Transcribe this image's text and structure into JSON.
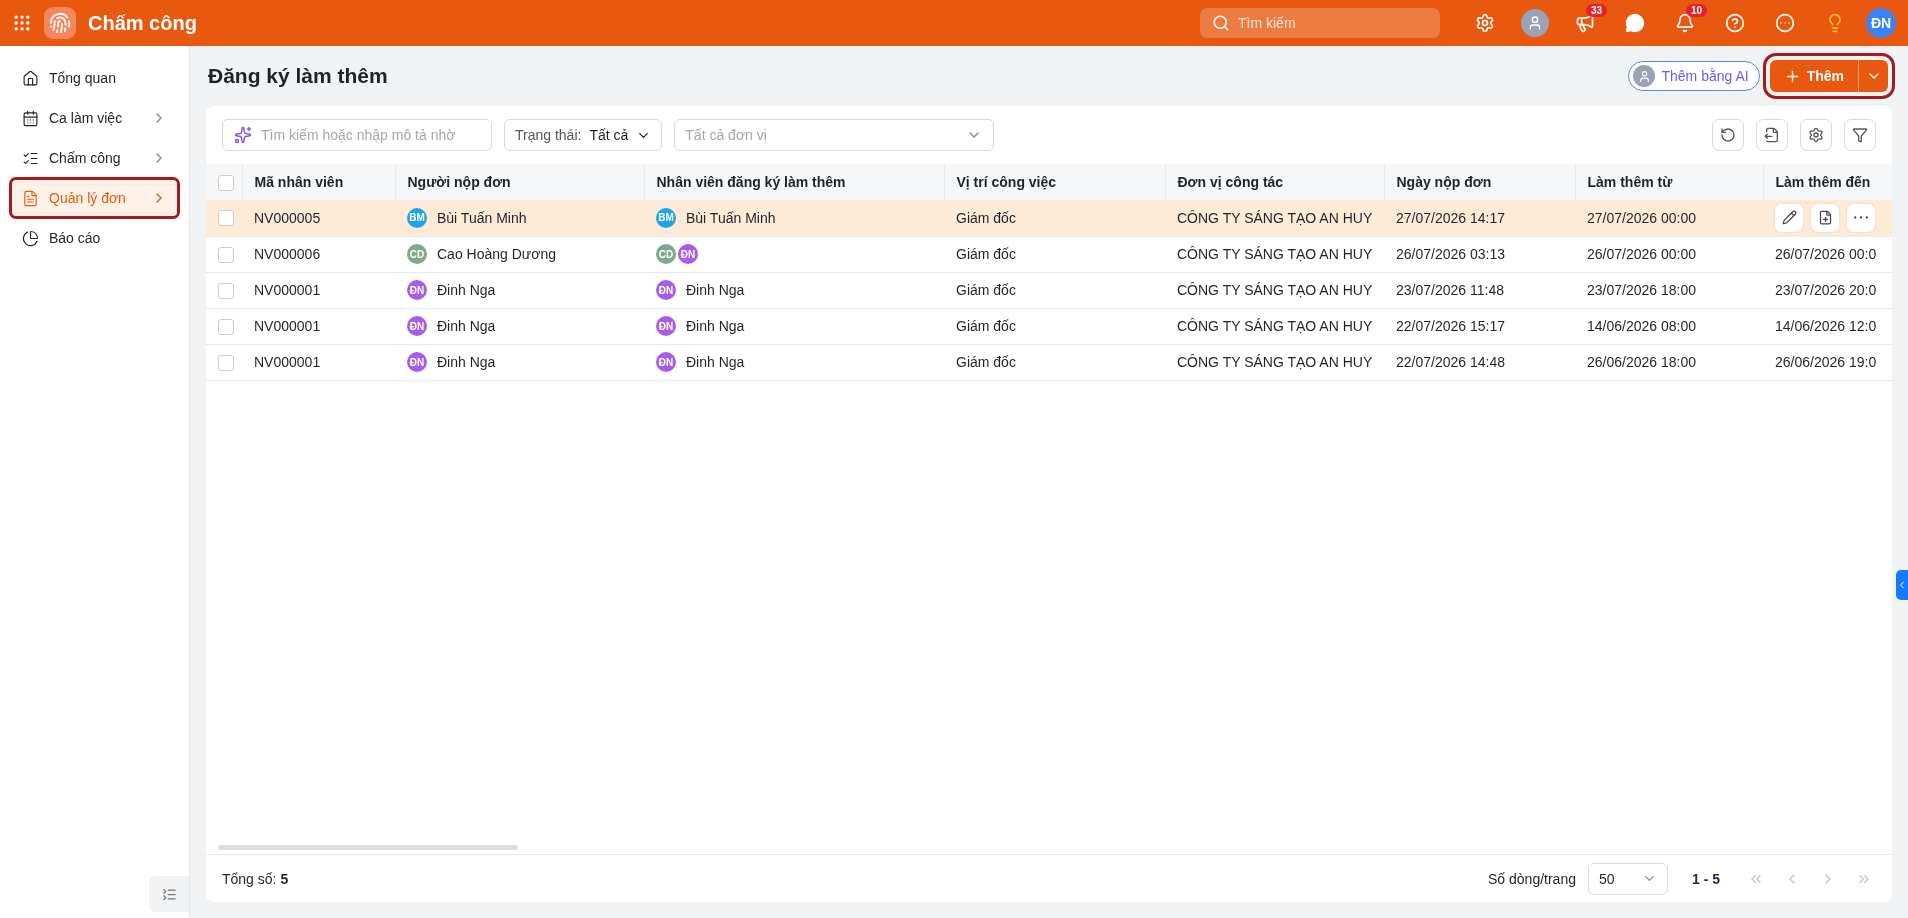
{
  "app": {
    "title": "Chấm công"
  },
  "topbar": {
    "search": {
      "placeholder": "Tìm kiếm"
    },
    "announcements_badge": "33",
    "notifications_badge": "10",
    "user_initials": "ĐN"
  },
  "sidebar": {
    "items": [
      {
        "label": "Tổng quan",
        "has_children": false,
        "selected": false,
        "outlined": false
      },
      {
        "label": "Ca làm việc",
        "has_children": true,
        "selected": false,
        "outlined": false
      },
      {
        "label": "Chấm công",
        "has_children": true,
        "selected": false,
        "outlined": false
      },
      {
        "label": "Quản lý đơn",
        "has_children": true,
        "selected": true,
        "outlined": true
      },
      {
        "label": "Báo cáo",
        "has_children": false,
        "selected": false,
        "outlined": false
      }
    ]
  },
  "page": {
    "title": "Đăng ký làm thêm",
    "ai_button": "Thêm bằng AI",
    "add_button": {
      "label": "Thêm",
      "outlined": true
    }
  },
  "filters": {
    "search": {
      "placeholder": "Tìm kiếm hoặc nhập mô tả nhờ"
    },
    "status": {
      "label": "Trạng thái:",
      "value": "Tất cả"
    },
    "unit": {
      "placeholder": "Tất cả đơn vị"
    }
  },
  "table": {
    "all_checked": false,
    "columns": [
      "Mã nhân viên",
      "Người nộp đơn",
      "Nhân viên đăng ký làm thêm",
      "Vị trí công việc",
      "Đơn vị công tác",
      "Ngày nộp đơn",
      "Làm thêm từ",
      "Làm thêm đến"
    ],
    "rows": [
      {
        "checked": false,
        "highlighted": true,
        "code": "NV000005",
        "submitter": {
          "initials": "BM",
          "color": "#1ea5e9",
          "name": "Bùi Tuấn Minh"
        },
        "employees": [
          {
            "initials": "BM",
            "color": "#1ea5e9",
            "name": "Bùi Tuấn Minh"
          }
        ],
        "position": "Giám đốc",
        "unit": "CÔNG TY SÁNG TẠO AN HUY",
        "submitted": "27/07/2026 14:17",
        "from": "27/07/2026 00:00"
      },
      {
        "checked": false,
        "highlighted": false,
        "code": "NV000006",
        "submitter": {
          "initials": "CD",
          "color": "#7fa88c",
          "name": "Cao Hoàng Dương"
        },
        "employees": [
          {
            "initials": "CD",
            "color": "#7fa88c"
          },
          {
            "initials": "ĐN",
            "color": "#a65ee8"
          }
        ],
        "position": "Giám đốc",
        "unit": "CÔNG TY SÁNG TẠO AN HUY",
        "submitted": "26/07/2026 03:13",
        "from": "26/07/2026 00:00",
        "to": "26/07/2026 00:0"
      },
      {
        "checked": false,
        "highlighted": false,
        "code": "NV000001",
        "submitter": {
          "initials": "ĐN",
          "color": "#a65ee8",
          "name": "Đinh Nga"
        },
        "employees": [
          {
            "initials": "ĐN",
            "color": "#a65ee8",
            "name": "Đinh Nga"
          }
        ],
        "position": "Giám đốc",
        "unit": "CÔNG TY SÁNG TẠO AN HUY",
        "submitted": "23/07/2026 11:48",
        "from": "23/07/2026 18:00",
        "to": "23/07/2026 20:0"
      },
      {
        "checked": false,
        "highlighted": false,
        "code": "NV000001",
        "submitter": {
          "initials": "ĐN",
          "color": "#a65ee8",
          "name": "Đinh Nga"
        },
        "employees": [
          {
            "initials": "ĐN",
            "color": "#a65ee8",
            "name": "Đinh Nga"
          }
        ],
        "position": "Giám đốc",
        "unit": "CÔNG TY SÁNG TẠO AN HUY",
        "submitted": "22/07/2026 15:17",
        "from": "14/06/2026 08:00",
        "to": "14/06/2026 12:0"
      },
      {
        "checked": false,
        "highlighted": false,
        "code": "NV000001",
        "submitter": {
          "initials": "ĐN",
          "color": "#a65ee8",
          "name": "Đinh Nga"
        },
        "employees": [
          {
            "initials": "ĐN",
            "color": "#a65ee8",
            "name": "Đinh Nga"
          }
        ],
        "position": "Giám đốc",
        "unit": "CÔNG TY SÁNG TẠO AN HUY",
        "submitted": "22/07/2026 14:48",
        "from": "26/06/2026 18:00",
        "to": "26/06/2026 19:0"
      }
    ]
  },
  "footer": {
    "total_label": "Tổng số:",
    "total": "5",
    "rows_per_page_label": "Số dòng/trang",
    "rows_per_page": "50",
    "range": "1 - 5"
  }
}
